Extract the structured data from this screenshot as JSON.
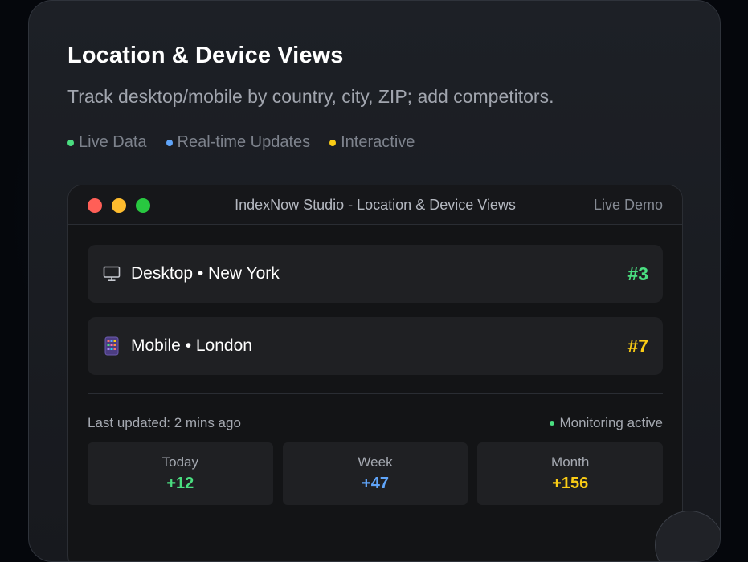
{
  "header": {
    "title": "Location & Device Views",
    "subtitle": "Track desktop/mobile by country, city, ZIP; add competitors."
  },
  "tags": [
    {
      "label": "Live Data",
      "color": "#4ade80"
    },
    {
      "label": "Real-time Updates",
      "color": "#60a5fa"
    },
    {
      "label": "Interactive",
      "color": "#facc15"
    }
  ],
  "window": {
    "title": "IndexNow Studio - Location & Device Views",
    "badge": "Live Demo",
    "lights": [
      "#ff5f57",
      "#febc2e",
      "#28c840"
    ]
  },
  "rows": [
    {
      "icon": "desktop-monitor-icon",
      "label": "Desktop • New York",
      "rank": "#3",
      "rank_color": "#4ade80"
    },
    {
      "icon": "mobile-phone-icon",
      "label": "Mobile • London",
      "rank": "#7",
      "rank_color": "#facc15"
    }
  ],
  "status": {
    "updated": "Last updated: 2 mins ago",
    "monitoring": "Monitoring active"
  },
  "stats": [
    {
      "label": "Today",
      "value": "+12",
      "color": "#4ade80"
    },
    {
      "label": "Week",
      "value": "+47",
      "color": "#60a5fa"
    },
    {
      "label": "Month",
      "value": "+156",
      "color": "#facc15"
    }
  ]
}
